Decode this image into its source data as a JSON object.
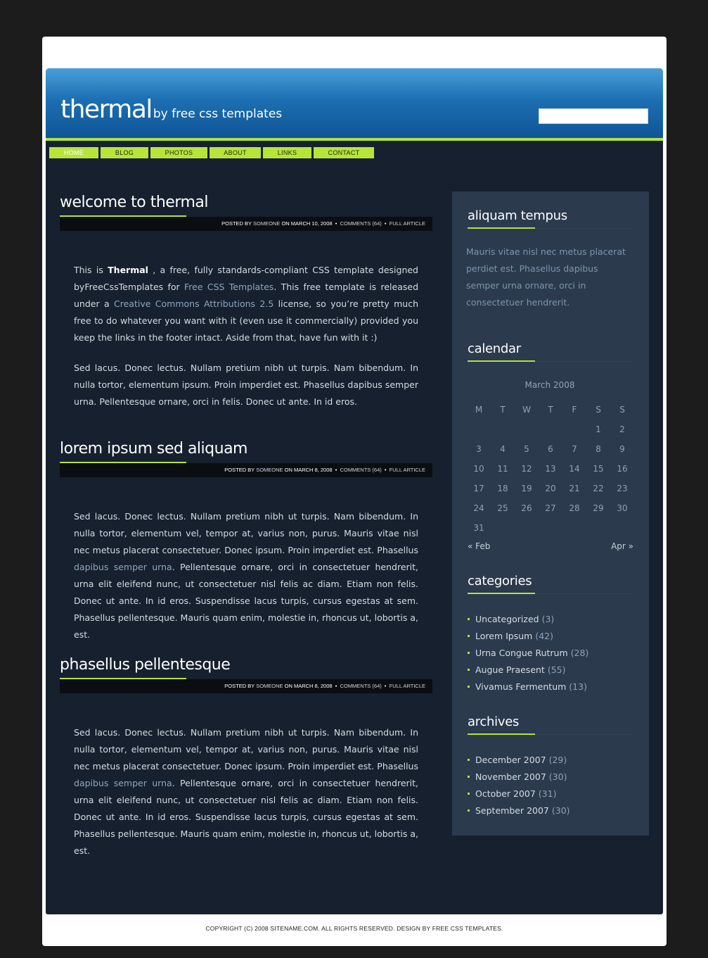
{
  "header": {
    "logo_main": "thermal",
    "logo_sub": "by free css templates",
    "search_value": ""
  },
  "menu": [
    "HOME",
    "BLOG",
    "PHOTOS",
    "ABOUT",
    "LINKS",
    "CONTACT"
  ],
  "posts": [
    {
      "title": "welcome to thermal",
      "meta": {
        "posted_by": "POSTED BY",
        "author": "SOMEONE",
        "on": "ON",
        "date": "MARCH 10, 2008",
        "comments": "COMMENTS (64)",
        "sep": "•",
        "full": "FULL ARTICLE"
      },
      "p1": {
        "t1": "This is ",
        "b1": "Thermal",
        "t2": " , a free, fully standards-compliant CSS template designed byFreeCssTemplates for ",
        "l1": "Free CSS Templates",
        "t3": ". This free template is released under a ",
        "l2": "Creative Commons Attributions 2.5",
        "t4": " license, so you’re pretty much free to do whatever you want with it (even use it commercially) provided you keep the links in the footer intact. Aside from that, have fun with it :)"
      },
      "p2": "Sed lacus. Donec lectus. Nullam pretium nibh ut turpis. Nam bibendum. In nulla tortor, elementum ipsum. Proin imperdiet est. Phasellus dapibus semper urna. Pellentesque ornare, orci in felis. Donec ut ante. In id eros."
    },
    {
      "title": "lorem ipsum sed aliquam",
      "meta": {
        "posted_by": "POSTED BY",
        "author": "SOMEONE",
        "on": "ON",
        "date": "MARCH 8, 2008",
        "comments": "COMMENTS (64)",
        "sep": "•",
        "full": "FULL ARTICLE"
      },
      "p1": {
        "t1": "Sed lacus. Donec lectus. Nullam pretium nibh ut turpis. Nam bibendum. In nulla tortor, elementum vel, tempor at, varius non, purus. Mauris vitae nisl nec metus placerat consectetuer. Donec ipsum. Proin imperdiet est. Phasellus ",
        "l1": "dapibus semper urna",
        "t2": ". Pellentesque ornare, orci in consectetuer hendrerit, urna elit eleifend nunc, ut consectetuer nisl felis ac diam. Etiam non felis. Donec ut ante. In id eros. Suspendisse lacus turpis, cursus egestas at sem. Phasellus pellentesque. Mauris quam enim, molestie in, rhoncus ut, lobortis a, est."
      }
    },
    {
      "title": "phasellus pellentesque",
      "meta": {
        "posted_by": "POSTED BY",
        "author": "SOMEONE",
        "on": "ON",
        "date": "MARCH 8, 2008",
        "comments": "COMMENTS (64)",
        "sep": "•",
        "full": "FULL ARTICLE"
      },
      "p1": {
        "t1": "Sed lacus. Donec lectus. Nullam pretium nibh ut turpis. Nam bibendum. In nulla tortor, elementum vel, tempor at, varius non, purus. Mauris vitae nisl nec metus placerat consectetuer. Donec ipsum. Proin imperdiet est. Phasellus ",
        "l1": "dapibus semper urna",
        "t2": ". Pellentesque ornare, orci in consectetuer hendrerit, urna elit eleifend nunc, ut consectetuer nisl felis ac diam. Etiam non felis. Donec ut ante. In id eros. Suspendisse lacus turpis, cursus egestas at sem. Phasellus pellentesque. Mauris quam enim, molestie in, rhoncus ut, lobortis a, est."
      }
    }
  ],
  "sidebar": {
    "aliquam": {
      "heading": "aliquam tempus",
      "text": "Mauris vitae nisl nec metus placerat perdiet est. Phasellus dapibus semper urna ornare, orci in consectetuer hendrerit."
    },
    "calendar": {
      "heading": "calendar",
      "caption": "March 2008",
      "days": [
        "M",
        "T",
        "W",
        "T",
        "F",
        "S",
        "S"
      ],
      "weeks": [
        [
          "",
          "",
          "",
          "",
          "",
          "1",
          "2"
        ],
        [
          "3",
          "4",
          "5",
          "6",
          "7",
          "8",
          "9"
        ],
        [
          "10",
          "11",
          "12",
          "13",
          "14",
          "15",
          "16"
        ],
        [
          "17",
          "18",
          "19",
          "20",
          "21",
          "22",
          "23"
        ],
        [
          "24",
          "25",
          "26",
          "27",
          "28",
          "29",
          "30"
        ],
        [
          "31",
          "",
          "",
          "",
          "",
          "",
          ""
        ]
      ],
      "prev": "« Feb",
      "next": "Apr »"
    },
    "categories": {
      "heading": "categories",
      "items": [
        {
          "label": "Uncategorized",
          "count": "(3)"
        },
        {
          "label": "Lorem Ipsum",
          "count": "(42)"
        },
        {
          "label": "Urna Congue Rutrum",
          "count": "(28)"
        },
        {
          "label": "Augue Praesent",
          "count": "(55)"
        },
        {
          "label": "Vivamus Fermentum",
          "count": "(13)"
        }
      ]
    },
    "archives": {
      "heading": "archives",
      "items": [
        {
          "label": "December 2007",
          "count": "(29)"
        },
        {
          "label": "November 2007",
          "count": "(30)"
        },
        {
          "label": "October 2007",
          "count": "(31)"
        },
        {
          "label": "September 2007",
          "count": "(30)"
        }
      ]
    }
  },
  "footer": "COPYRIGHT (C) 2008 SITENAME.COM. ALL RIGHTS RESERVED. DESIGN BY FREE CSS TEMPLATES.",
  "colors": {
    "accent_green": "#b4e33a",
    "header_blue": "#1c6fb2",
    "content_bg": "#16202e",
    "sidebar_bg": "#2b3a4d"
  }
}
